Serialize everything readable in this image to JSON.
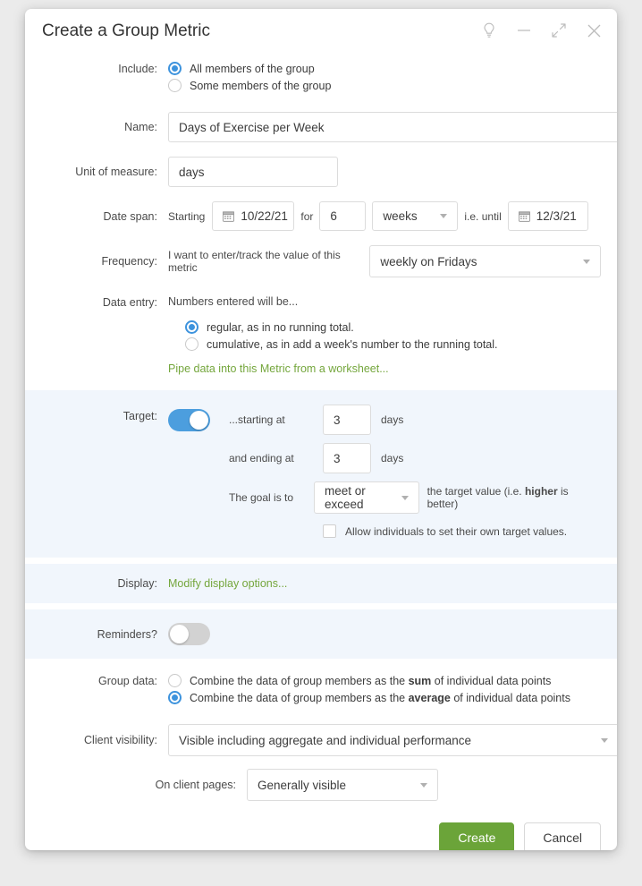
{
  "window": {
    "title": "Create a Group Metric",
    "controls": [
      {
        "name": "hint-lightbulb-icon",
        "label": "Hint"
      },
      {
        "name": "minimize-icon",
        "label": "Minimize"
      },
      {
        "name": "expand-icon",
        "label": "Expand"
      },
      {
        "name": "close-icon",
        "label": "Close"
      }
    ]
  },
  "include": {
    "label": "Include:",
    "options": [
      {
        "label": "All members of the group",
        "selected": true
      },
      {
        "label": "Some members of the group",
        "selected": false
      }
    ]
  },
  "name": {
    "label": "Name:",
    "value": "Days of Exercise per Week"
  },
  "unit": {
    "label": "Unit of measure:",
    "value": "days"
  },
  "date_span": {
    "label": "Date span:",
    "starting_text": "Starting",
    "start_date": "10/22/21",
    "for_text": "for",
    "duration": "6",
    "duration_unit": "weeks",
    "until_text": "i.e. until",
    "end_date": "12/3/21"
  },
  "frequency": {
    "label": "Frequency:",
    "prefix": "I want to enter/track the value of this metric",
    "value": "weekly on Fridays"
  },
  "data_entry": {
    "label": "Data entry:",
    "heading": "Numbers entered will be...",
    "options": [
      {
        "label": "regular, as in no running total.",
        "selected": true
      },
      {
        "label": "cumulative, as in add a week's number to the running total.",
        "selected": false
      }
    ],
    "pipe_link": "Pipe data into this Metric from a worksheet..."
  },
  "target": {
    "label": "Target:",
    "enabled": true,
    "starting_label": "...starting at",
    "starting_value": "3",
    "starting_unit": "days",
    "ending_label": "and ending at",
    "ending_value": "3",
    "ending_unit": "days",
    "goal_label": "The goal is to",
    "goal_value": "meet or exceed",
    "goal_suffix_pre": "the target value (i.e. ",
    "goal_suffix_bold": "higher",
    "goal_suffix_post": " is better)",
    "allow_individual_label": "Allow individuals to set their own target values.",
    "allow_individual_checked": false
  },
  "display": {
    "label": "Display:",
    "link": "Modify display options..."
  },
  "reminders": {
    "label": "Reminders?",
    "enabled": false
  },
  "group_data": {
    "label": "Group data:",
    "options": [
      {
        "pre": "Combine the data of group members as the ",
        "bold": "sum",
        "post": " of individual data points",
        "selected": false
      },
      {
        "pre": "Combine the data of group members as the ",
        "bold": "average",
        "post": " of individual data points",
        "selected": true
      }
    ]
  },
  "client_visibility": {
    "label": "Client visibility:",
    "value": "Visible including aggregate and individual performance"
  },
  "client_pages": {
    "label": "On client pages:",
    "value": "Generally visible"
  },
  "actions": {
    "create": "Create",
    "cancel": "Cancel"
  },
  "colors": {
    "accent_blue": "#4c9ede",
    "green": "#6ba439",
    "link_green": "#74a63c",
    "band": "#f1f6fc"
  }
}
